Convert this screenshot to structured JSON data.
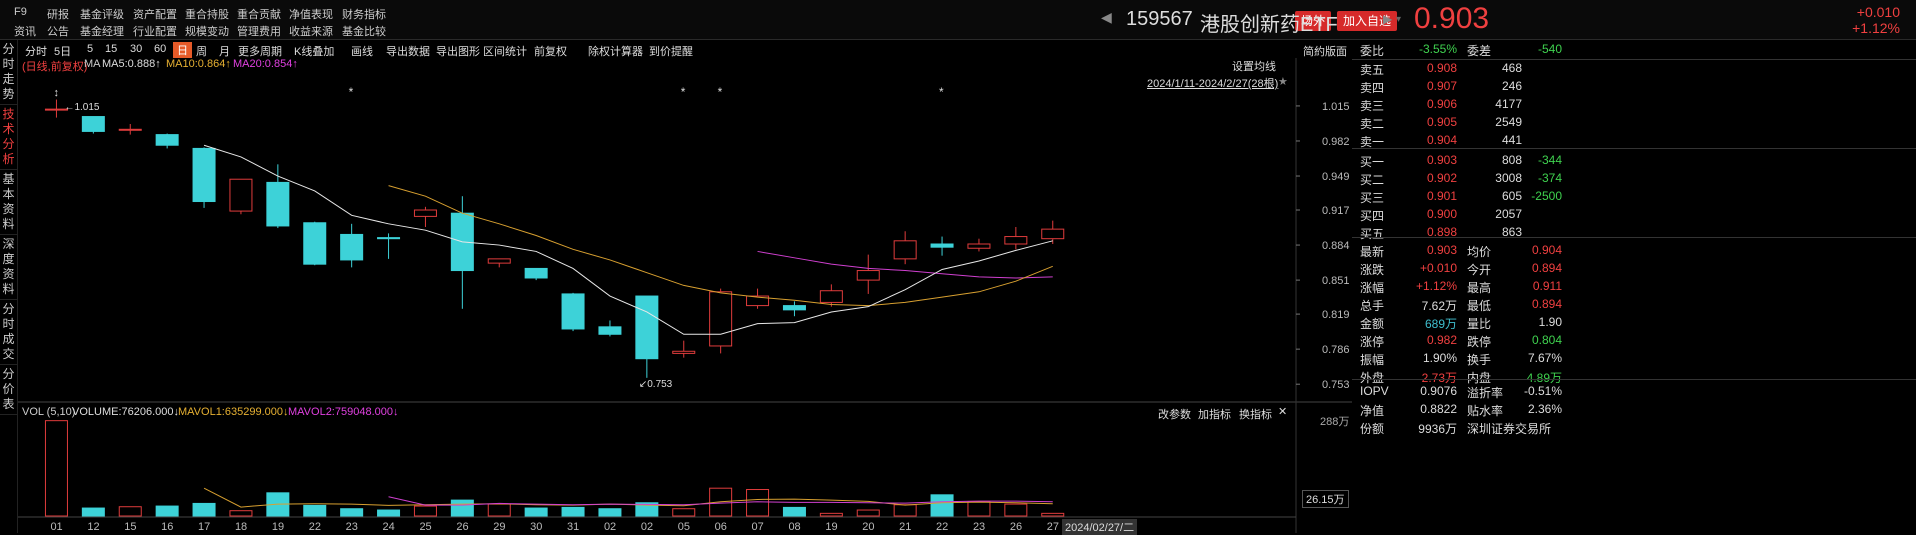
{
  "topbar": {
    "f9": "F9",
    "zixun": "资讯",
    "menu_row1": [
      "研报",
      "基金评级",
      "资产配置",
      "重合持股",
      "重合贡献",
      "净值表现",
      "财务指标"
    ],
    "menu_row2": [
      "公告",
      "基金经理",
      "行业配置",
      "规模变动",
      "管理费用",
      "收益来源",
      "基金比较"
    ],
    "badge_market": "场外",
    "badge_fav": "加入自选",
    "code": "159567",
    "name": "港股创新药ETF",
    "price": "0.903",
    "change": "+0.010",
    "change_pct": "+1.12%"
  },
  "left_tabs": [
    "分时走势",
    "技术分析",
    "基本资料",
    "深度资料",
    "分时成交",
    "分价表"
  ],
  "toolbar": {
    "items": [
      "分时",
      "5日",
      "5",
      "15",
      "30",
      "60",
      "日",
      "周",
      "月",
      "更多周期",
      "K线叠加",
      "画线",
      "导出数据",
      "导出图形",
      "区间统计",
      "前复权",
      "除权计算器",
      "到价提醒"
    ],
    "selected": "日",
    "right": "简約版面"
  },
  "chart_legend": {
    "type": "(日线,前复权)",
    "ma": "MA",
    "ma5": "MA5:0.888↑",
    "ma10": "MA10:0.864↑",
    "ma20": "MA20:0.854↑",
    "setting": "设置均线",
    "range": "2024/1/11-2024/2/27(28根)"
  },
  "vol_legend": {
    "label": "VOL (5,10)",
    "volume": "VOLUME:76206.000↓",
    "mavol1": "MAVOL1:635299.000↓",
    "mavol2": "MAVOL2:759048.000↓",
    "buttons": [
      "改参数",
      "加指标",
      "换指标"
    ],
    "close": "✕"
  },
  "volume_axis": [
    "288万",
    "26.15万"
  ],
  "cursor_date": "2024/02/27/二",
  "chart_data": {
    "type": "candlestick",
    "x": [
      "01",
      "12",
      "15",
      "16",
      "17",
      "18",
      "19",
      "22",
      "23",
      "24",
      "25",
      "26",
      "29",
      "30",
      "31",
      "02",
      "02",
      "05",
      "06",
      "07",
      "08",
      "19",
      "20",
      "21",
      "22",
      "23",
      "26",
      "27"
    ],
    "ylim": [
      0.74,
      1.03
    ],
    "y_ticks": [
      1.015,
      0.982,
      0.949,
      0.917,
      0.884,
      0.851,
      0.819,
      0.786,
      0.753
    ],
    "open": [
      1.012,
      1.005,
      0.993,
      0.988,
      0.975,
      0.916,
      0.943,
      0.905,
      0.894,
      0.891,
      0.911,
      0.914,
      0.867,
      0.862,
      0.838,
      0.807,
      0.836,
      0.782,
      0.789,
      0.827,
      0.827,
      0.83,
      0.851,
      0.871,
      0.885,
      0.881,
      0.885,
      0.89
    ],
    "close": [
      1.012,
      0.991,
      0.993,
      0.978,
      0.925,
      0.946,
      0.902,
      0.866,
      0.87,
      0.89,
      0.917,
      0.86,
      0.871,
      0.853,
      0.805,
      0.8,
      0.777,
      0.784,
      0.84,
      0.836,
      0.823,
      0.841,
      0.86,
      0.888,
      0.882,
      0.885,
      0.892,
      0.899
    ],
    "high": [
      1.021,
      1.005,
      0.998,
      0.989,
      0.976,
      0.946,
      0.96,
      0.906,
      0.904,
      0.895,
      0.92,
      0.93,
      0.871,
      0.862,
      0.839,
      0.813,
      0.836,
      0.794,
      0.843,
      0.843,
      0.831,
      0.847,
      0.875,
      0.897,
      0.892,
      0.89,
      0.901,
      0.907
    ],
    "low": [
      1.004,
      0.989,
      0.988,
      0.975,
      0.919,
      0.913,
      0.9,
      0.865,
      0.863,
      0.871,
      0.901,
      0.824,
      0.863,
      0.851,
      0.803,
      0.798,
      0.759,
      0.778,
      0.782,
      0.824,
      0.817,
      0.826,
      0.838,
      0.866,
      0.874,
      0.878,
      0.88,
      0.885
    ],
    "ma5": [
      null,
      null,
      null,
      null,
      0.978,
      0.967,
      0.949,
      0.935,
      0.912,
      0.904,
      0.898,
      0.887,
      0.884,
      0.878,
      0.862,
      0.836,
      0.821,
      0.8,
      0.8,
      0.81,
      0.811,
      0.821,
      0.826,
      0.842,
      0.861,
      0.869,
      0.879,
      0.888
    ],
    "ma10": [
      null,
      null,
      null,
      null,
      null,
      null,
      null,
      null,
      null,
      0.94,
      0.93,
      0.914,
      0.904,
      0.893,
      0.88,
      0.87,
      0.858,
      0.846,
      0.839,
      0.835,
      0.832,
      0.828,
      0.827,
      0.83,
      0.835,
      0.84,
      0.85,
      0.864
    ],
    "ma20": [
      null,
      null,
      null,
      null,
      null,
      null,
      null,
      null,
      null,
      null,
      null,
      null,
      null,
      null,
      null,
      null,
      null,
      null,
      null,
      0.878,
      0.872,
      0.866,
      0.862,
      0.86,
      0.857,
      0.854,
      0.853,
      0.854
    ],
    "volume": [
      288,
      24,
      28,
      30,
      38,
      16,
      70,
      32,
      22,
      18,
      30,
      48,
      36,
      24,
      26,
      22,
      40,
      22,
      84,
      80,
      26,
      8,
      18,
      34,
      64,
      44,
      36,
      8
    ],
    "mavol1": [
      null,
      null,
      null,
      null,
      84,
      27,
      36,
      37,
      36,
      32,
      34,
      36,
      37,
      34,
      33,
      36,
      33,
      31,
      43,
      50,
      51,
      48,
      44,
      33,
      40,
      42,
      40,
      37
    ],
    "mavol2": [
      null,
      null,
      null,
      null,
      null,
      null,
      null,
      null,
      null,
      58,
      33,
      33,
      38,
      36,
      34,
      36,
      35,
      34,
      39,
      43,
      41,
      41,
      40,
      39,
      43,
      45,
      45,
      43
    ],
    "labels": {
      "max": "1.015",
      "min": "0.753"
    }
  },
  "right_panel": {
    "webi": {
      "label": "委比",
      "value": "-3.55%",
      "label2": "委差",
      "value2": "-540"
    },
    "sell": [
      {
        "l": "卖五",
        "p": "0.908",
        "v": "468"
      },
      {
        "l": "卖四",
        "p": "0.907",
        "v": "246"
      },
      {
        "l": "卖三",
        "p": "0.906",
        "v": "4177"
      },
      {
        "l": "卖二",
        "p": "0.905",
        "v": "2549"
      },
      {
        "l": "卖一",
        "p": "0.904",
        "v": "441"
      }
    ],
    "buy": [
      {
        "l": "买一",
        "p": "0.903",
        "v": "808",
        "c": "-344"
      },
      {
        "l": "买二",
        "p": "0.902",
        "v": "3008",
        "c": "-374"
      },
      {
        "l": "买三",
        "p": "0.901",
        "v": "605",
        "c": "-2500"
      },
      {
        "l": "买四",
        "p": "0.900",
        "v": "2057",
        "c": ""
      },
      {
        "l": "买五",
        "p": "0.898",
        "v": "863",
        "c": ""
      }
    ],
    "stats": [
      {
        "l1": "最新",
        "v1": "0.903",
        "c1": "red",
        "l2": "均价",
        "v2": "0.904",
        "c2": "red"
      },
      {
        "l1": "涨跌",
        "v1": "+0.010",
        "c1": "red",
        "l2": "今开",
        "v2": "0.894",
        "c2": "red"
      },
      {
        "l1": "涨幅",
        "v1": "+1.12%",
        "c1": "red",
        "l2": "最高",
        "v2": "0.911",
        "c2": "red"
      },
      {
        "l1": "总手",
        "v1": "7.62万",
        "c1": "white",
        "l2": "最低",
        "v2": "0.894",
        "c2": "red"
      },
      {
        "l1": "金额",
        "v1": "689万",
        "c1": "cyan",
        "l2": "量比",
        "v2": "1.90",
        "c2": "white"
      },
      {
        "l1": "涨停",
        "v1": "0.982",
        "c1": "red",
        "l2": "跌停",
        "v2": "0.804",
        "c2": "green"
      },
      {
        "l1": "振幅",
        "v1": "1.90%",
        "c1": "white",
        "l2": "换手",
        "v2": "7.67%",
        "c2": "white"
      },
      {
        "l1": "外盘",
        "v1": "2.73万",
        "c1": "red",
        "l2": "内盘",
        "v2": "4.89万",
        "c2": "green"
      }
    ],
    "stats2": [
      {
        "l1": "IOPV",
        "v1": "0.9076",
        "l2": "溢折率",
        "v2": "-0.51%"
      },
      {
        "l1": "净值",
        "v1": "0.8822",
        "l2": "贴水率",
        "v2": "2.36%"
      },
      {
        "l1": "份额",
        "v1": "9936万",
        "l2": "深圳证券交易所",
        "v2": ""
      }
    ]
  }
}
